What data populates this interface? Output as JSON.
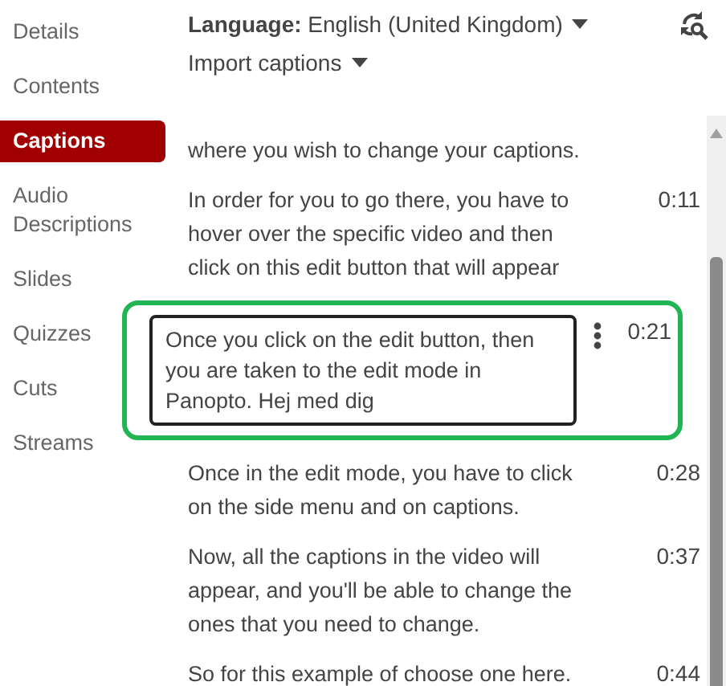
{
  "sidebar": {
    "items": [
      {
        "label": "Details",
        "selected": false
      },
      {
        "label": "Contents",
        "selected": false
      },
      {
        "label": "Captions",
        "selected": true
      },
      {
        "label": "Audio Descriptions",
        "selected": false
      },
      {
        "label": "Slides",
        "selected": false
      },
      {
        "label": "Quizzes",
        "selected": false
      },
      {
        "label": "Cuts",
        "selected": false
      },
      {
        "label": "Streams",
        "selected": false
      }
    ]
  },
  "language": {
    "label": "Language:",
    "value": "English (United Kingdom)"
  },
  "import_captions": "Import captions",
  "captions": [
    {
      "text": "where you wish to change your captions.",
      "editing": false,
      "highlighted": false
    },
    {
      "text": "In order for you to go there, you have to hover over the specific video and then click on this edit button that will appear",
      "time": "0:11",
      "editing": false,
      "highlighted": false
    },
    {
      "text": "Once you click on the edit button, then you are taken to the edit mode in Panopto. Hej med dig",
      "time": "0:21",
      "editing": true,
      "highlighted": true
    },
    {
      "text": "Once in the edit mode, you have to click on the side menu and on captions.",
      "time": "0:28",
      "editing": false,
      "highlighted": false
    },
    {
      "text": "Now, all the captions in the video will appear, and you'll be able to change the ones that you need to change.",
      "time": "0:37",
      "editing": false,
      "highlighted": false
    },
    {
      "text": "So for this example of choose one here.",
      "time": "0:44",
      "editing": false,
      "highlighted": false
    }
  ]
}
